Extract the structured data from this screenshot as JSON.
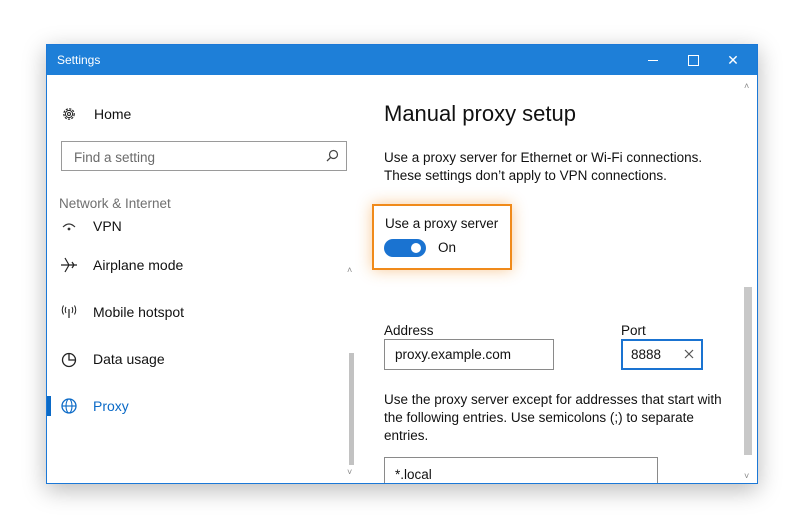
{
  "window": {
    "title": "Settings",
    "minimize_label": "—",
    "close_label": "✕",
    "accent": "#1e7fd8"
  },
  "sidebar": {
    "home_label": "Home",
    "search_placeholder": "Find a setting",
    "section_heading": "Network & Internet",
    "items": [
      {
        "label": "VPN",
        "icon": "vpn-icon"
      },
      {
        "label": "Airplane mode",
        "icon": "airplane-icon"
      },
      {
        "label": "Mobile hotspot",
        "icon": "hotspot-icon"
      },
      {
        "label": "Data usage",
        "icon": "data-usage-icon"
      },
      {
        "label": "Proxy",
        "icon": "globe-icon",
        "selected": true
      }
    ],
    "selected_color": "#0b6ac7"
  },
  "main": {
    "title": "Manual proxy setup",
    "description": "Use a proxy server for Ethernet or Wi-Fi connections. These settings don’t apply to VPN connections.",
    "toggle": {
      "label": "Use a proxy server",
      "state": "On",
      "on": true
    },
    "address": {
      "label": "Address",
      "value": "proxy.example.com"
    },
    "port": {
      "label": "Port",
      "value": "8888"
    },
    "exceptions_description": "Use the proxy server except for addresses that start with the following entries. Use semicolons (;) to separate entries.",
    "exceptions_value": "*.local",
    "highlight_color": "#f08a1a"
  }
}
